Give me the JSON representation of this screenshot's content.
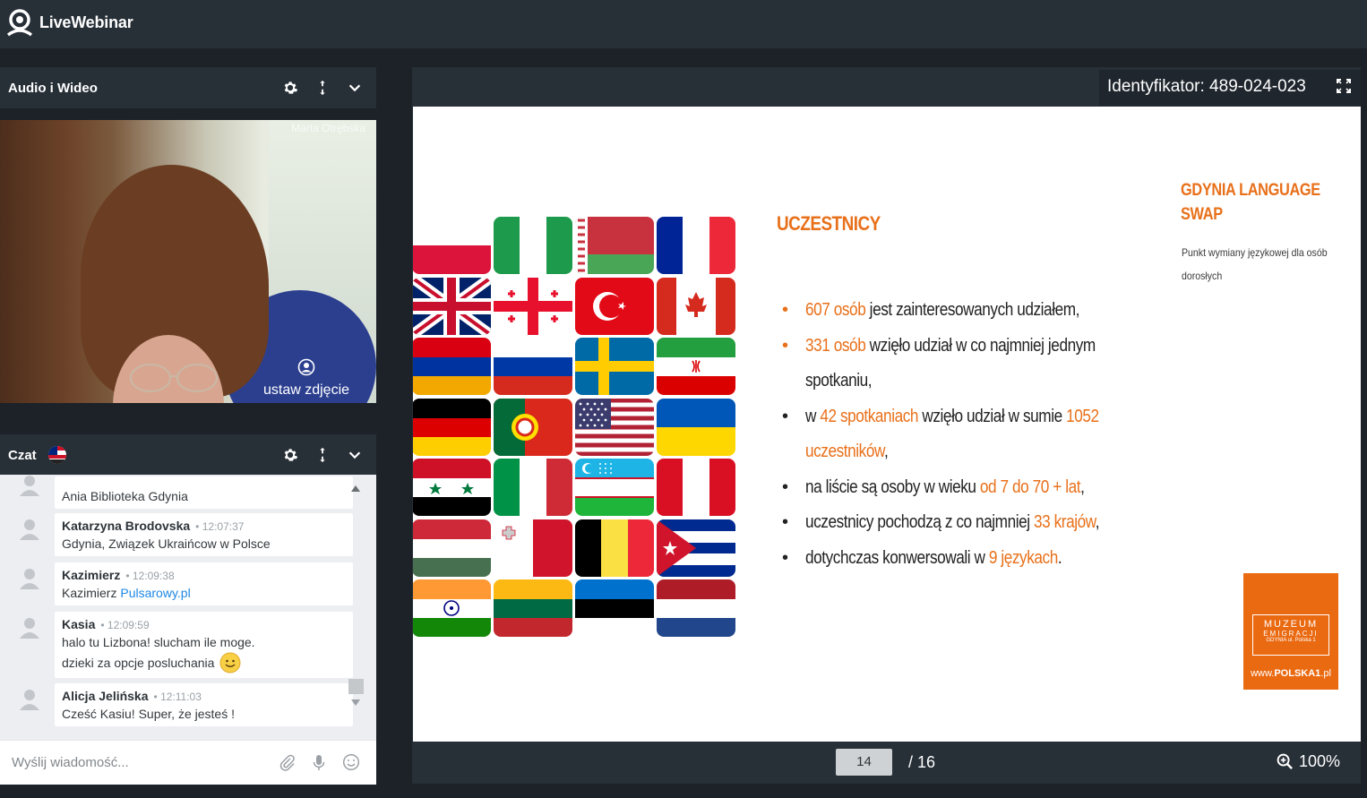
{
  "app": {
    "name": "LiveWebinar"
  },
  "audio_video": {
    "title": "Audio i Wideo",
    "participant_name": "Marta Otrębska",
    "set_photo_label": "ustaw zdjęcie"
  },
  "chat": {
    "title": "Czat",
    "messages": [
      {
        "author": "",
        "time": "",
        "lines": [
          "Ania Biblioteka Gdynia"
        ]
      },
      {
        "author": "Katarzyna Brodovska",
        "time": "12:07:37",
        "lines": [
          "Gdynia, Związek Ukraińcow w Polsce"
        ]
      },
      {
        "author": "Kazimierz",
        "time": "12:09:38",
        "text_prefix": "Kazimierz ",
        "link": "Pulsarowy.pl"
      },
      {
        "author": "Kasia",
        "time": "12:09:59",
        "lines": [
          "halo tu Lizbona! slucham ile moge.",
          "dzieki za opcje posluchania"
        ],
        "emoji": "slightly-smiling-face"
      },
      {
        "author": "Alicja Jelińska",
        "time": "12:11:03",
        "lines": [
          "Cześć Kasiu! Super, że jesteś !"
        ]
      }
    ],
    "input_placeholder": "Wyślij wiadomość..."
  },
  "presentation": {
    "identifier": "Identyfikator: 489-024-023",
    "page_current": "14",
    "page_total": "/ 16",
    "zoom": "100%"
  },
  "slide": {
    "title": "UCZESTNICY",
    "brand_title": "GDYNIA LANGUAGE SWAP",
    "brand_subtitle": "Punkt wymiany językowej dla osób dorosłych",
    "bullets": [
      {
        "dot_color": "orange",
        "parts": [
          {
            "t": "607 osób",
            "h": true
          },
          {
            "t": " jest zainteresowanych udziałem,",
            "h": false
          }
        ]
      },
      {
        "dot_color": "orange",
        "parts": [
          {
            "t": "331 osób",
            "h": true
          },
          {
            "t": " wzięło udział w co najmniej jednym",
            "h": false
          }
        ]
      },
      {
        "dot_color": "none",
        "parts": [
          {
            "t": "spotkaniu,",
            "h": false
          }
        ]
      },
      {
        "dot_color": "black",
        "parts": [
          {
            "t": "w ",
            "h": false
          },
          {
            "t": "42 spotkaniach",
            "h": true
          },
          {
            "t": " wzięło udział w sumie ",
            "h": false
          },
          {
            "t": "1052",
            "h": true
          }
        ]
      },
      {
        "dot_color": "none",
        "parts": [
          {
            "t": "uczestników",
            "h": true
          },
          {
            "t": ",",
            "h": false
          }
        ]
      },
      {
        "dot_color": "black",
        "parts": [
          {
            "t": "na liście są osoby w wieku ",
            "h": false
          },
          {
            "t": "od 7 do 70 + lat",
            "h": true
          },
          {
            "t": ",",
            "h": false
          }
        ]
      },
      {
        "dot_color": "black",
        "parts": [
          {
            "t": "uczestnicy pochodzą z co najmniej ",
            "h": false
          },
          {
            "t": "33 krajów",
            "h": true
          },
          {
            "t": ",",
            "h": false
          }
        ]
      },
      {
        "dot_color": "black",
        "parts": [
          {
            "t": "dotychczas konwersowali w ",
            "h": false
          },
          {
            "t": "9 językach",
            "h": true
          },
          {
            "t": ".",
            "h": false
          }
        ]
      }
    ],
    "logo": {
      "line1": "MUZEUM",
      "line2": "EMIGRACJI",
      "line3": "GDYNIA ul. Polska 1",
      "www_prefix": "www.",
      "www_bold": "POLSKA1",
      "www_suffix": ".pl"
    },
    "flags": [
      "poland",
      "nigeria",
      "belarus",
      "france",
      "uk",
      "georgia",
      "turkey",
      "canada",
      "armenia",
      "russia",
      "sweden",
      "iran",
      "germany",
      "portugal",
      "usa",
      "ukraine",
      "syria",
      "italy",
      "uzbekistan",
      "peru",
      "hungary",
      "malta",
      "belgium",
      "cuba",
      "india",
      "lithuania",
      "estonia",
      "netherlands"
    ]
  },
  "colors": {
    "accent": "#e8701a",
    "topbar": "#272f37",
    "background": "#1c2228",
    "link": "#1e88e5"
  }
}
